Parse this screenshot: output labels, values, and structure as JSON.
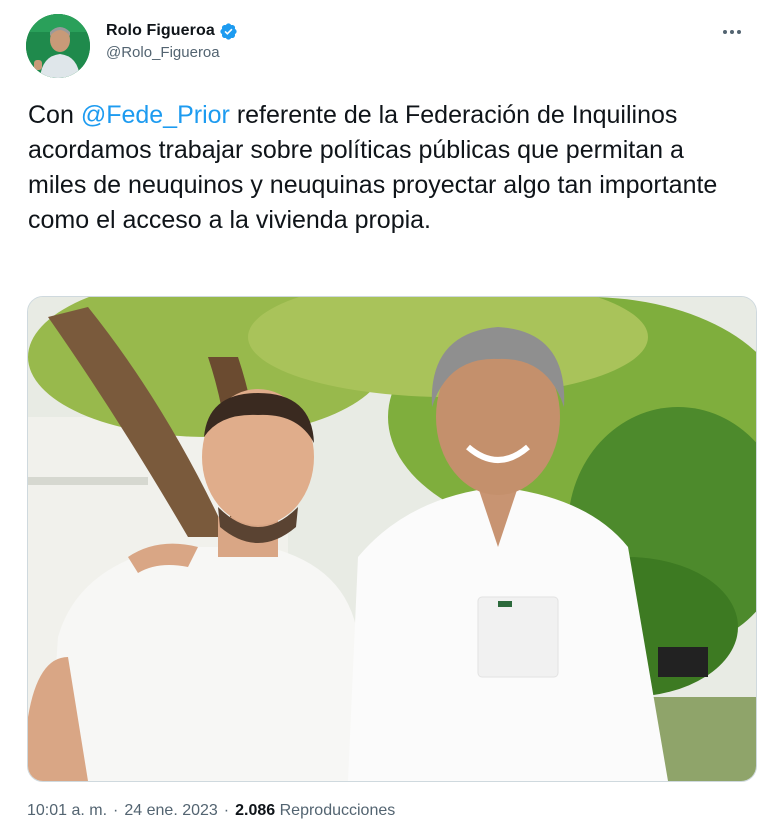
{
  "author": {
    "display_name": "Rolo Figueroa",
    "handle": "@Rolo_Figueroa",
    "verified": true
  },
  "tweet": {
    "text_before_mention": "Con ",
    "mention": "@Fede_Prior",
    "text_after_mention": " referente de la Federación de Inquilinos acordamos trabajar sobre políticas públicas que permitan a miles de neuquinos y neuquinas proyectar algo tan importante como el acceso a la vivienda propia."
  },
  "meta": {
    "time": "10:01 a. m.",
    "separator": "·",
    "date": "24 ene. 2023",
    "views_count": "2.086",
    "views_label": "Reproducciones"
  },
  "icons": {
    "more": "more-horizontal-icon",
    "verified": "verified-badge-icon"
  },
  "colors": {
    "link": "#1d9bf0",
    "text": "#0f1419",
    "secondary": "#536471"
  }
}
